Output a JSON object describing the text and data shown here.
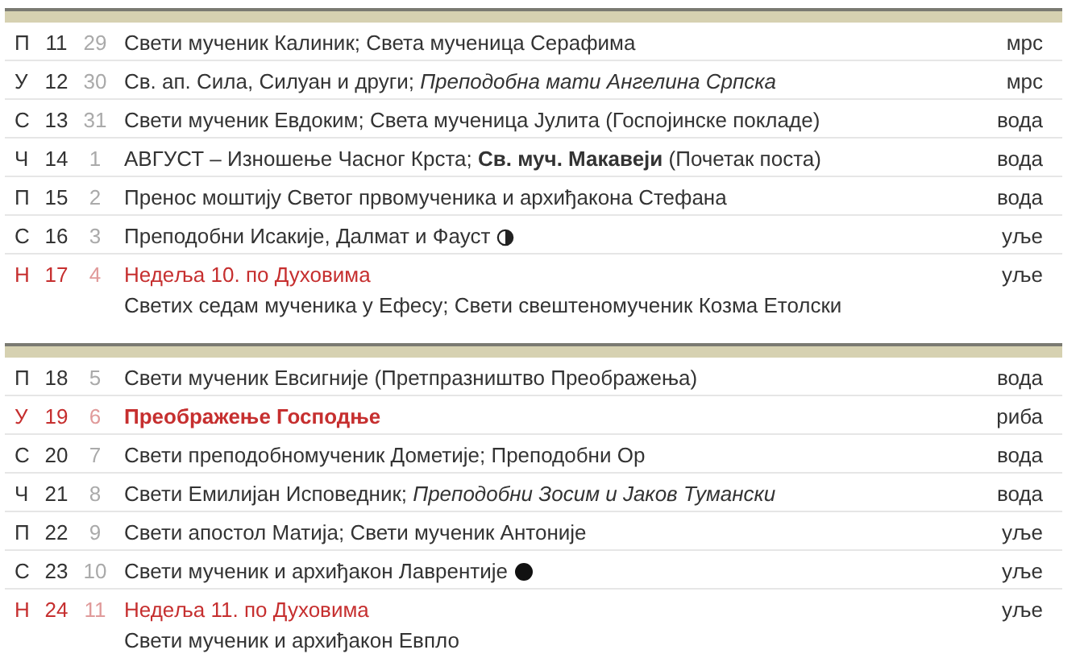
{
  "weeks": [
    {
      "rows": [
        {
          "dow": "П",
          "day": "11",
          "old_day": "29",
          "title": "Свети мученик Калиник; Света мученица Серафима",
          "fast": "мрс",
          "holiday": false,
          "bold": false
        },
        {
          "dow": "У",
          "day": "12",
          "old_day": "30",
          "title": "Св. ап. Сила, Силуан и други; *Преподобна мати Ангелина Српска*",
          "fast": "мрс",
          "holiday": false,
          "bold": false
        },
        {
          "dow": "С",
          "day": "13",
          "old_day": "31",
          "title": "Свети мученик Евдоким; Света мученица Јулита (Госпојинске покладе)",
          "fast": "вода",
          "holiday": false,
          "bold": false
        },
        {
          "dow": "Ч",
          "day": "14",
          "old_day": "1",
          "title": "АВГУСТ – Изношење Часног Крста; **Св. муч. Макавеји** (Почетак поста)",
          "fast": "вода",
          "holiday": false,
          "bold": false
        },
        {
          "dow": "П",
          "day": "15",
          "old_day": "2",
          "title": "Пренос моштију Светог првомученика и архиђакона Стефана",
          "fast": "вода",
          "holiday": false,
          "bold": false
        },
        {
          "dow": "С",
          "day": "16",
          "old_day": "3",
          "title": "Преподобни Исакије, Далмат и Фауст",
          "moon": {
            "kind": "half"
          },
          "fast": "уље",
          "holiday": false,
          "bold": false
        },
        {
          "dow": "Н",
          "day": "17",
          "old_day": "4",
          "title": "Недеља 10. по Духовима",
          "subtitle": "Светих седам мученика у Ефесу; Свети свештеномученик Козма Етолски",
          "fast": "уље",
          "holiday": true,
          "bold": false
        }
      ]
    },
    {
      "rows": [
        {
          "dow": "П",
          "day": "18",
          "old_day": "5",
          "title": "Свети мученик Евсигније (Претпразништво Преображења)",
          "fast": "вода",
          "holiday": false,
          "bold": false
        },
        {
          "dow": "У",
          "day": "19",
          "old_day": "6",
          "title": "Преображење Господње",
          "fast": "риба",
          "holiday": true,
          "bold": true
        },
        {
          "dow": "С",
          "day": "20",
          "old_day": "7",
          "title": "Свети преподобномученик Дометије; Преподобни Ор",
          "fast": "вода",
          "holiday": false,
          "bold": false
        },
        {
          "dow": "Ч",
          "day": "21",
          "old_day": "8",
          "title": "Свети Емилијан Исповедник; *Преподобни Зосим и Јаков Тумански*",
          "fast": "вода",
          "holiday": false,
          "bold": false
        },
        {
          "dow": "П",
          "day": "22",
          "old_day": "9",
          "title": "Свети апостол Матија; Свети мученик Антоније",
          "fast": "уље",
          "holiday": false,
          "bold": false
        },
        {
          "dow": "С",
          "day": "23",
          "old_day": "10",
          "title": "Свети мученик и архиђакон Лаврентије",
          "moon": {
            "kind": "full"
          },
          "fast": "уље",
          "holiday": false,
          "bold": false
        },
        {
          "dow": "Н",
          "day": "24",
          "old_day": "11",
          "title": "Недеља 11. по Духовима",
          "subtitle": "Свети мученик и архиђакон Евпло",
          "fast": "уље",
          "holiday": true,
          "bold": false
        }
      ]
    }
  ]
}
